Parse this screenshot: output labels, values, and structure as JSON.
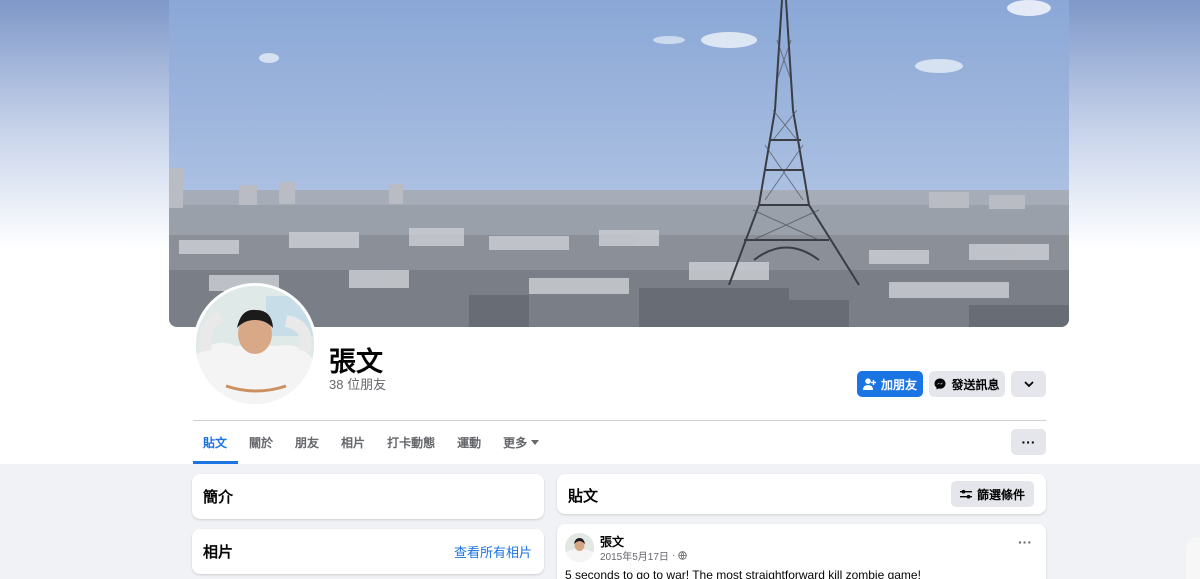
{
  "profile": {
    "name": "張文",
    "friends_count": "38 位朋友"
  },
  "actions": {
    "add_friend": "加朋友",
    "message": "發送訊息",
    "more_icon": "chevron-down-icon"
  },
  "tabs": [
    {
      "label": "貼文",
      "active": true
    },
    {
      "label": "關於"
    },
    {
      "label": "朋友"
    },
    {
      "label": "相片"
    },
    {
      "label": "打卡動態"
    },
    {
      "label": "運動"
    },
    {
      "label": "更多"
    }
  ],
  "sidebar": {
    "intro_title": "簡介",
    "photos_title": "相片",
    "see_all_photos": "查看所有相片"
  },
  "posts": {
    "title": "貼文",
    "filter_label": "篩選條件",
    "items": [
      {
        "author": "張文",
        "date": "2015年5月17日",
        "privacy_icon": "globe-icon",
        "text": "5 seconds to go to war! The most straightforward kill zombie game!"
      }
    ]
  },
  "colors": {
    "accent": "#1b74e4",
    "background": "#f0f2f5",
    "secondary_button": "#e4e6eb"
  }
}
